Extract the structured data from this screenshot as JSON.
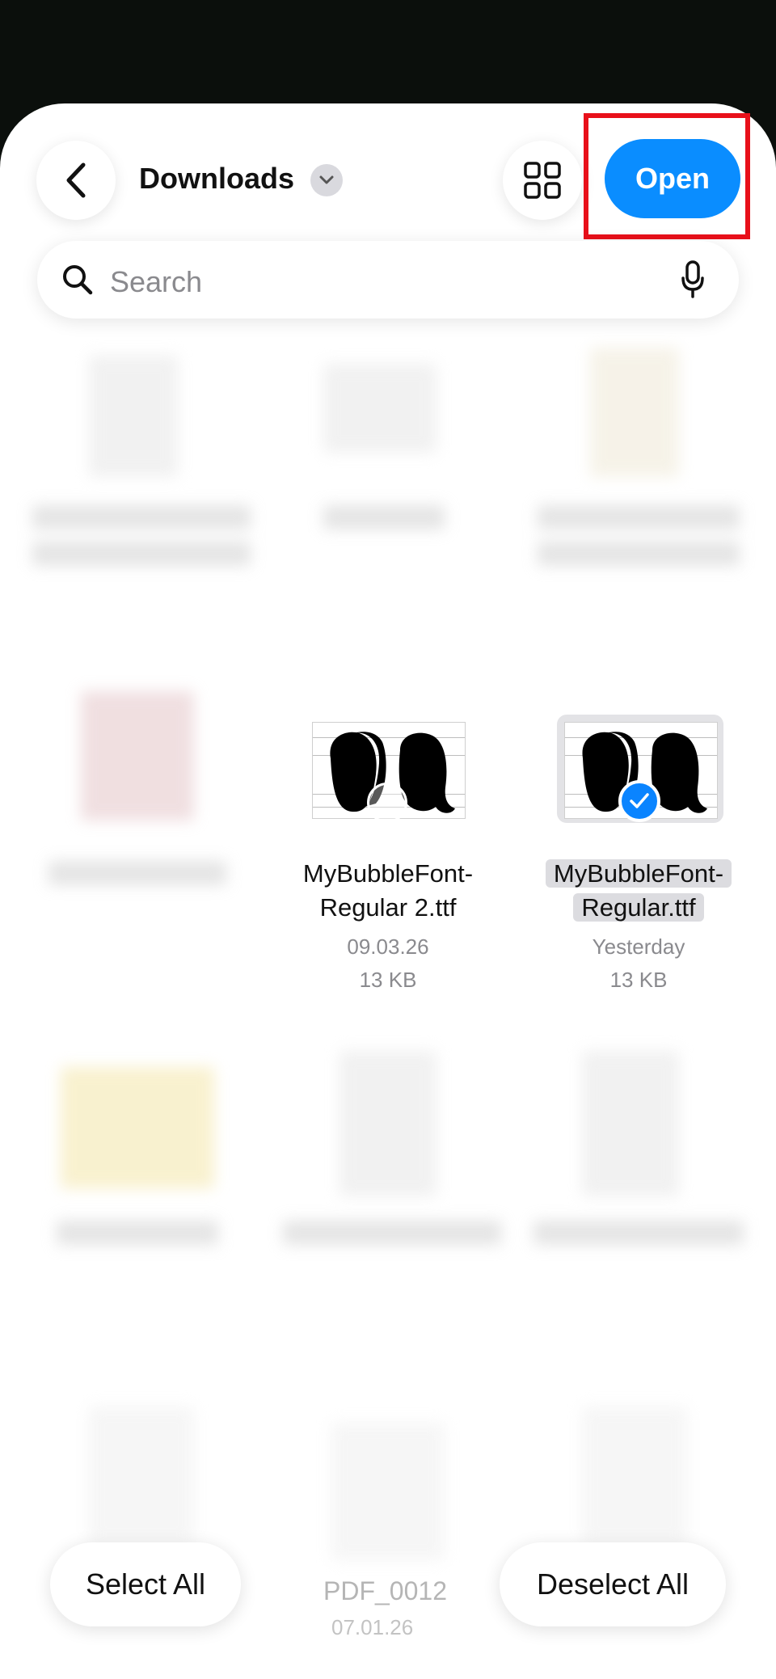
{
  "header": {
    "back_icon": "chevron-left-icon",
    "title": "Downloads",
    "title_dropdown_icon": "chevron-down-icon",
    "view_toggle_icon": "grid-icon",
    "open_label": "Open"
  },
  "search": {
    "placeholder": "Search",
    "search_icon": "magnifier-icon",
    "mic_icon": "microphone-icon"
  },
  "files": [
    {
      "name_line1": "MyBubbleFont-",
      "name_line2": "Regular 2.ttf",
      "date": "09.03.26",
      "size": "13 KB",
      "selected": false
    },
    {
      "name_line1": "MyBubbleFont-",
      "name_line2": "Regular.ttf",
      "date": "Yesterday",
      "size": "13 KB",
      "selected": true
    }
  ],
  "background_items": {
    "partial_label": "PDF_0012",
    "partial_date": "07.01.26"
  },
  "bottom": {
    "select_all": "Select All",
    "deselect_all": "Deselect All"
  },
  "colors": {
    "accent": "#0a8dff",
    "highlight": "#e8101a"
  }
}
